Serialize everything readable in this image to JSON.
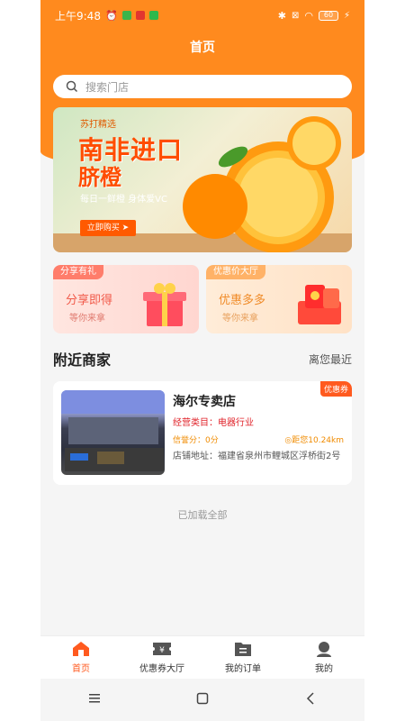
{
  "status": {
    "time": "上午9:48",
    "battery": "60"
  },
  "header": {
    "title": "首页"
  },
  "search": {
    "placeholder": "搜索门店"
  },
  "banner": {
    "brand": "苏打精选",
    "title_line1": "南非进口",
    "title_line2": "脐橙",
    "subtitle": "每日一鲜橙 身体爱VC",
    "buy_button": "立即购买 ➤"
  },
  "promo_cards": [
    {
      "tag": "分享有礼",
      "headline": "分享即得",
      "sub": "等你来拿"
    },
    {
      "tag": "优惠价大厅",
      "headline": "优惠多多",
      "sub": "等你来拿"
    }
  ],
  "nearby": {
    "heading": "附近商家",
    "sort": "离您最近"
  },
  "shop": {
    "coupon_badge": "优惠券",
    "name": "海尔专卖店",
    "category": "经营类目：电器行业",
    "score": "信誉分：0分",
    "distance": "距您10.24km",
    "address": "店铺地址：福建省泉州市鲤城区浮桥街2号"
  },
  "footer_note": "已加载全部",
  "tabs": [
    {
      "label": "首页",
      "icon": "home-icon",
      "active": true
    },
    {
      "label": "优惠券大厅",
      "icon": "coupon-icon",
      "active": false
    },
    {
      "label": "我的订单",
      "icon": "orders-icon",
      "active": false
    },
    {
      "label": "我的",
      "icon": "user-icon",
      "active": false
    }
  ],
  "colors": {
    "primary": "#ff8a1e",
    "accent": "#ff5a1f"
  }
}
